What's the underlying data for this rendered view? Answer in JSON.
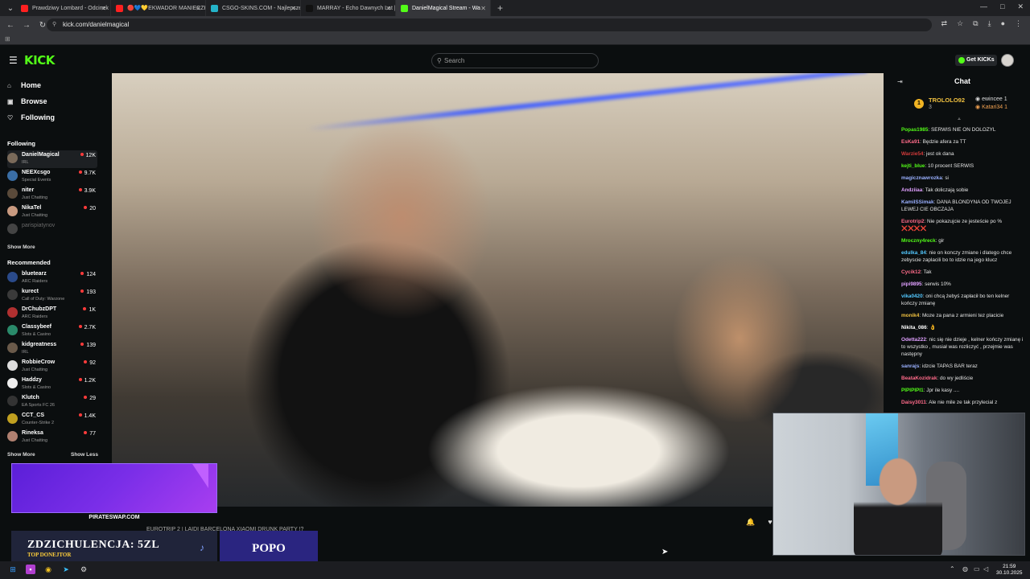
{
  "browser": {
    "tabs": [
      {
        "title": "Prawdziwy Lombard - Odcinek",
        "favicon_color": "#ff2020"
      },
      {
        "title": "🔴💙💛EKWADOR MANIECZKI",
        "favicon_color": "#ff2020"
      },
      {
        "title": "CSGO-SKINS.COM - Najlepsze",
        "favicon_color": "#24b3c8"
      },
      {
        "title": "MARRAY - Echo Dawnych Lat |",
        "favicon_color": "#111111"
      },
      {
        "title": "DanielMagical Stream - Wa",
        "favicon_color": "#53fc18"
      }
    ],
    "url": "kick.com/danielmagical",
    "window_controls": [
      "—",
      "□",
      "✕"
    ]
  },
  "kick": {
    "logo": "KICK",
    "search_placeholder": "Search",
    "get_kicks_label": "Get KICKs"
  },
  "sidebar": {
    "nav": [
      {
        "label": "Home",
        "icon": "home-icon",
        "glyph": "⌂"
      },
      {
        "label": "Browse",
        "icon": "browse-icon",
        "glyph": "▣"
      },
      {
        "label": "Following",
        "icon": "heart-icon",
        "glyph": "♡"
      }
    ],
    "following_header": "Following",
    "following": [
      {
        "name": "DanielMagical",
        "category": "IRL",
        "viewers": "12K",
        "color": "#7a6a5a"
      },
      {
        "name": "NEEXcsgo",
        "category": "Special Events",
        "viewers": "9.7K",
        "color": "#3a6ea5"
      },
      {
        "name": "niter",
        "category": "Just Chatting",
        "viewers": "3.9K",
        "color": "#5a4a3a"
      },
      {
        "name": "NikaTel",
        "category": "Just Chatting",
        "viewers": "20",
        "color": "#c99a80"
      },
      {
        "name": "parispiatynov",
        "category": "",
        "viewers": "",
        "color": "#444444"
      }
    ],
    "show_more": "Show More",
    "recommended_header": "Recommended",
    "recommended": [
      {
        "name": "bluetearz",
        "category": "ARC Raiders",
        "viewers": "124",
        "color": "#2a4a8a"
      },
      {
        "name": "kurect",
        "category": "Call of Duty: Warzone",
        "viewers": "193",
        "color": "#3a3a3a"
      },
      {
        "name": "DrChubzDPT",
        "category": "ARC Raiders",
        "viewers": "1K",
        "color": "#b03030"
      },
      {
        "name": "Classybeef",
        "category": "Slots & Casino",
        "viewers": "2.7K",
        "color": "#2a8a6a"
      },
      {
        "name": "kidgreatness",
        "category": "IRL",
        "viewers": "139",
        "color": "#6a5a4a"
      },
      {
        "name": "RobbieCrow",
        "category": "Just Chatting",
        "viewers": "92",
        "color": "#dddddd"
      },
      {
        "name": "Haddzy",
        "category": "Slots & Casino",
        "viewers": "1.2K",
        "color": "#eeeeee"
      },
      {
        "name": "Klutch",
        "category": "EA Sports FC 26",
        "viewers": "29",
        "color": "#333333"
      },
      {
        "name": "CCT_CS",
        "category": "Counter-Strike 2",
        "viewers": "1.4K",
        "color": "#c0a020"
      },
      {
        "name": "Rineksa",
        "category": "Just Chatting",
        "viewers": "77",
        "color": "#b08070"
      }
    ],
    "show_more_2": "Show More",
    "show_less": "Show Less"
  },
  "overlay": {
    "ad_label": "PIRATESWAP.COM",
    "dono_main": "ZDZICHULENCJA: 5ZL",
    "dono_sub": "TOP DONEJTOR",
    "popo": "POPO",
    "stream_title": "EUROTRIP 2 | LAIDI BARCELONA XIAOMI DRUNK PARTY !?"
  },
  "chat": {
    "title": "Chat",
    "pinned": {
      "top1_name": "TROLOLO92",
      "top1_count": "3",
      "top2_name": "ewincee",
      "top2_count": "1",
      "top3_name": "Katari34",
      "top3_count": "1"
    },
    "messages": [
      {
        "user": "Popas1985",
        "color": "#53fc18",
        "text": "SERWIS NIE ON DOLOZYL"
      },
      {
        "user": "EsKa91",
        "color": "#ff6b8a",
        "text": "Będzie afera za TT"
      },
      {
        "user": "Warzie54",
        "color": "#d23a3a",
        "text": "jest ok dana"
      },
      {
        "user": "kejti_blue",
        "color": "#53fc18",
        "text": "10 procent SERWIS"
      },
      {
        "user": "magicznawrozka",
        "color": "#9ab0ff",
        "text": "si"
      },
      {
        "user": "Andziiaa",
        "color": "#e0a0ff",
        "text": "Tak doliczają sobie"
      },
      {
        "user": "KamilSSimak",
        "color": "#9ab0ff",
        "text": "DANA BLONDYNA OD TWOJEJ LEWEJ CIE OBCZAJA"
      },
      {
        "user": "Eurotrip2",
        "color": "#ff6b8a",
        "text": "Nie pokazujcie ze jesteście po % ❌❌❌❌"
      },
      {
        "user": "Mroczny4reck",
        "color": "#53fc18",
        "text": "gir"
      },
      {
        "user": "edulka_84",
        "color": "#53c8ff",
        "text": "nie on konczy zmiane i dlatego chce zebyscie zaplacili bo to idzie na jego klucz"
      },
      {
        "user": "Cycik12",
        "color": "#ff6b8a",
        "text": "Tak"
      },
      {
        "user": "pipi9895",
        "color": "#e0a0ff",
        "text": "serwis 10%"
      },
      {
        "user": "vika0420",
        "color": "#53c8ff",
        "text": "oni chcą żebyś zapłacił bo ten kelner kończy zmianę"
      },
      {
        "user": "monik4",
        "color": "#f0c040",
        "text": "Moze za pana z armieni tez placicie"
      },
      {
        "user": "Nikita_086",
        "color": "#ffffff",
        "text": "👌"
      },
      {
        "user": "Odetta222",
        "color": "#e0a0ff",
        "text": "nic się nie dzieje , kelner kończy zmianę i to wszystko , musiał was rozliczyć , przejmie was następny"
      },
      {
        "user": "sanrajs",
        "color": "#9ab0ff",
        "text": "idzcie TAPAS BAR teraz"
      },
      {
        "user": "BeataKozidrak",
        "color": "#ff6b8a",
        "text": "do wy jedliście"
      },
      {
        "user": "PIPIPIPI1",
        "color": "#53fc18",
        "text": "Jpr ile kasy ...."
      },
      {
        "user": "Daisy3011",
        "color": "#ff6b8a",
        "text": "Ale nie mile ze tak przylecial z"
      }
    ]
  },
  "taskbar": {
    "time": "21:59",
    "date": "30.10.2025"
  }
}
